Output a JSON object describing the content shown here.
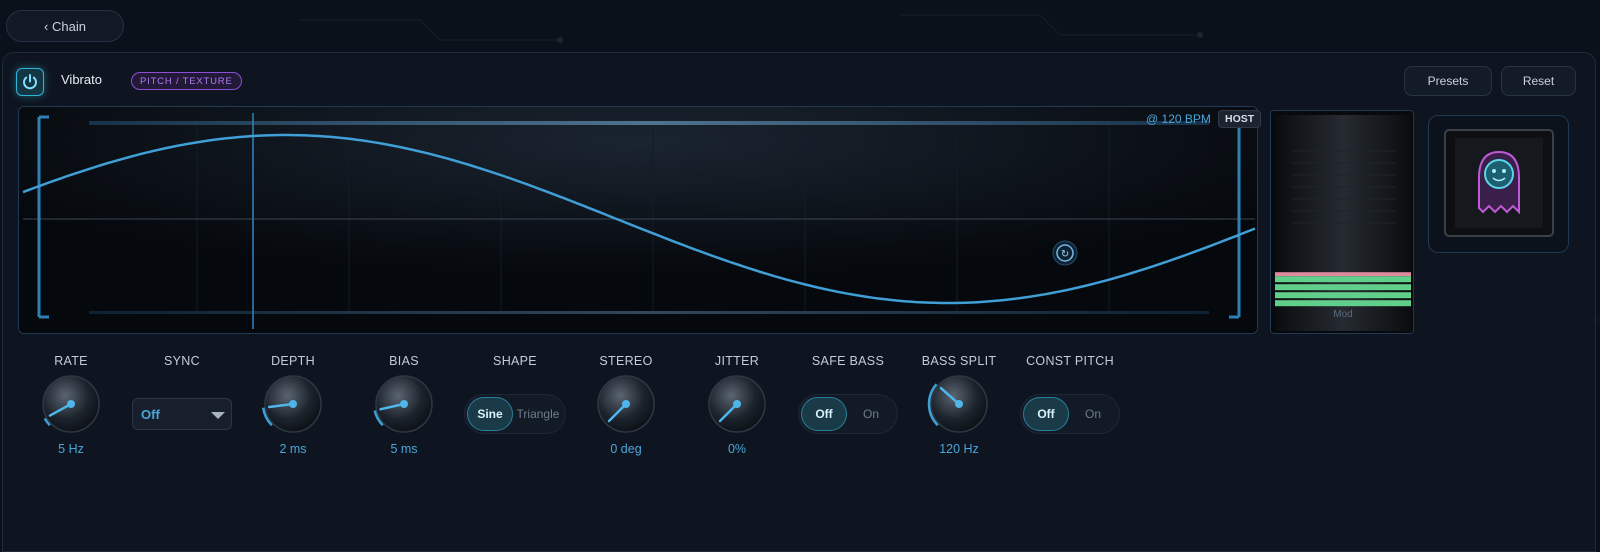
{
  "nav": {
    "back_label": "‹ Chain"
  },
  "plugin": {
    "title": "Vibrato",
    "tag": "PITCH / TEXTURE",
    "power_icon": "power-icon"
  },
  "header": {
    "presets_label": "Presets",
    "reset_label": "Reset"
  },
  "scope": {
    "bpm_label": "@ 120 BPM",
    "host_label": "HOST",
    "waveform": "sine",
    "playhead_icon": "playhead-icon"
  },
  "meter": {
    "label": "Mod",
    "level": 0.3,
    "fill_color": "#5fcf8a"
  },
  "avatar": {
    "icon": "ghost-icon"
  },
  "controls": {
    "rate": {
      "label": "RATE",
      "value": "5 Hz",
      "amount": 0.06
    },
    "sync": {
      "label": "SYNC",
      "value": "Off"
    },
    "depth": {
      "label": "DEPTH",
      "value": "2 ms",
      "amount": 0.14
    },
    "bias": {
      "label": "BIAS",
      "value": "5 ms",
      "amount": 0.12
    },
    "shape": {
      "label": "SHAPE",
      "options": [
        "Sine",
        "Triangle"
      ],
      "selected": "Sine"
    },
    "stereo": {
      "label": "STEREO",
      "value": "0 deg",
      "amount": 0.0
    },
    "jitter": {
      "label": "JITTER",
      "value": "0%",
      "amount": 0.0
    },
    "safe_bass": {
      "label": "SAFE BASS",
      "options": [
        "Off",
        "On"
      ],
      "selected": "Off"
    },
    "bass_split": {
      "label": "BASS SPLIT",
      "value": "120 Hz",
      "amount": 0.32
    },
    "const_pitch": {
      "label": "CONST PITCH",
      "options": [
        "Off",
        "On"
      ],
      "selected": "Off"
    }
  },
  "colors": {
    "accent": "#4aa6d8",
    "wave": "#3f9fd6",
    "tag": "#8b4fd6"
  }
}
